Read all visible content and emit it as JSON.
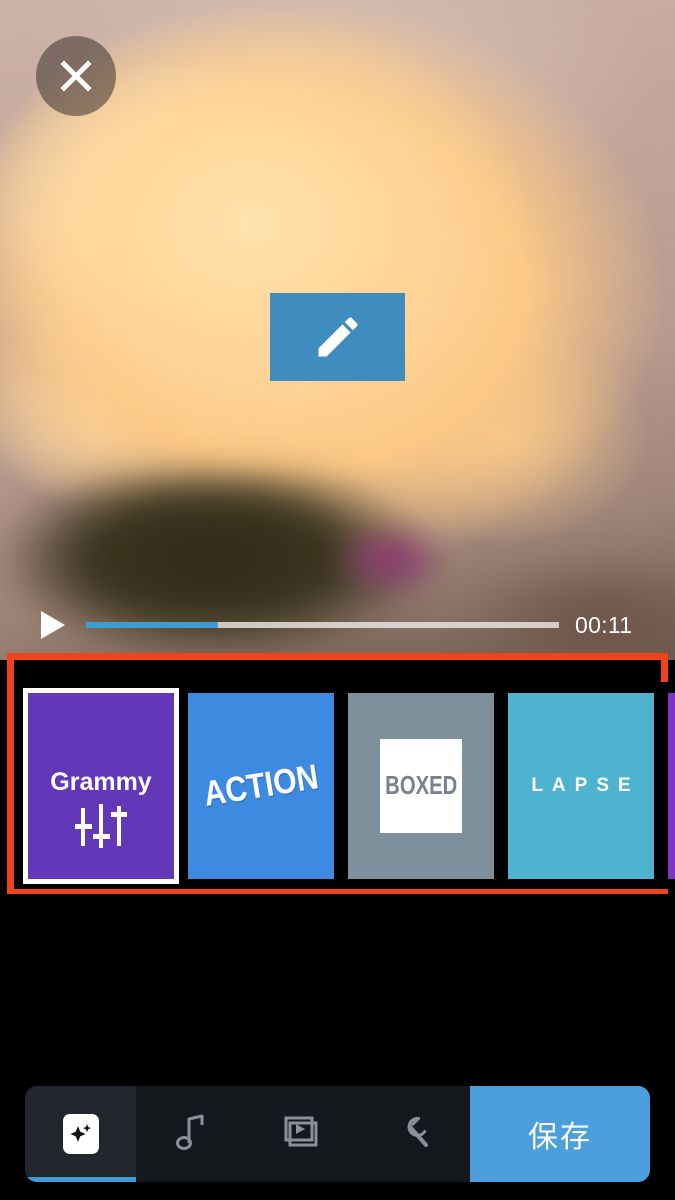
{
  "app": {
    "theme_background": "#000000",
    "accent_blue": "#4a9fdc",
    "highlight_border": "#f1421e"
  },
  "preview": {
    "close_button": {
      "icon": "close-icon",
      "label": ""
    },
    "edit_badge": {
      "icon": "pencil-icon",
      "background": "#3f8dbf"
    }
  },
  "transport": {
    "play_icon": "play-icon",
    "progress_percent": 28,
    "time_label": "00:11",
    "fill_color": "#3f9bd4",
    "track_color": "#ece6e0"
  },
  "filter_strip": {
    "highlighted": true,
    "highlight_color": "#f1421e",
    "cards": [
      {
        "name": "grammy",
        "label": "Grammy",
        "background": "#6238b9",
        "text_color": "#ffffff",
        "selected": true,
        "icon": "sliders-icon"
      },
      {
        "name": "action",
        "label": "ACTION",
        "background": "#3d8ae0",
        "text_color": "#ffffff",
        "selected": false,
        "icon": ""
      },
      {
        "name": "boxed",
        "label": "BOXED",
        "background": "#7e909c",
        "text_color": "#76838d",
        "selected": false,
        "icon": ""
      },
      {
        "name": "lapse",
        "label": "LAPSE",
        "background": "#4db3ce",
        "text_color": "#ffffff",
        "selected": false,
        "icon": ""
      },
      {
        "name": "next-partial",
        "label": "",
        "background": "#7e35c4",
        "text_color": "#ffffff",
        "selected": false,
        "icon": ""
      }
    ]
  },
  "toolbar": {
    "tabs": [
      {
        "name": "effects",
        "icon": "magic-sparkle-icon",
        "active": true
      },
      {
        "name": "music",
        "icon": "music-note-icon",
        "active": false
      },
      {
        "name": "clips",
        "icon": "video-clips-icon",
        "active": false
      },
      {
        "name": "tools",
        "icon": "wrench-icon",
        "active": false
      }
    ],
    "save_label": "保存"
  }
}
